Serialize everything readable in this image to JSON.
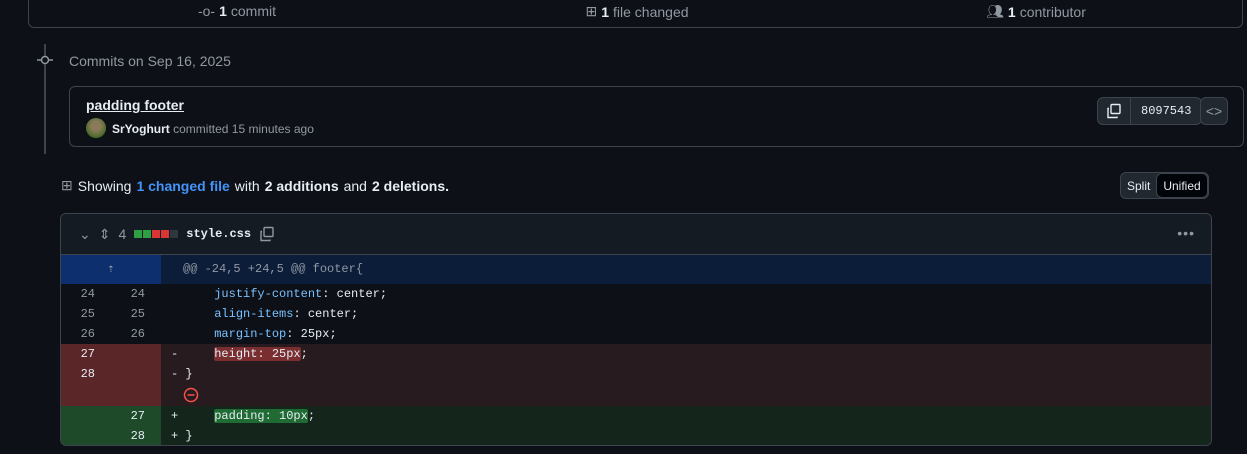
{
  "summary": {
    "commits_n": "1",
    "commits_label": "commit",
    "files_n": "1",
    "files_label": "file changed",
    "contributors_n": "1",
    "contributors_label": "contributor"
  },
  "timeline": {
    "date_label": "Commits on Sep 16, 2025"
  },
  "commit": {
    "title": "padding footer",
    "author": "SrYoghurt",
    "meta": "committed 15 minutes ago",
    "sha": "8097543"
  },
  "showing": {
    "prefix": "Showing",
    "link": "1 changed file",
    "mid": "with",
    "additions": "2 additions",
    "and": "and",
    "deletions": "2 deletions."
  },
  "view_toggle": {
    "split": "Split",
    "unified": "Unified"
  },
  "file": {
    "changes": "4",
    "name": "style.css",
    "colors": {
      "add": "#2ea043",
      "del": "#da3633",
      "neutral": "#30363d"
    },
    "hunk": "@@ -24,5 +24,5 @@ footer{",
    "lines": [
      {
        "type": "ctx",
        "old": "24",
        "new": "24",
        "sign": " ",
        "prop": "justify-content",
        "val": ": center;"
      },
      {
        "type": "ctx",
        "old": "25",
        "new": "25",
        "sign": " ",
        "prop": "align-items",
        "val": ": center;"
      },
      {
        "type": "ctx",
        "old": "26",
        "new": "26",
        "sign": " ",
        "prop": "margin-top",
        "val": ": 25px;"
      }
    ],
    "del1": {
      "old": "27",
      "sign": "-",
      "text": "height: 25px",
      "tail": ";"
    },
    "del2": {
      "old": "28",
      "sign": "-",
      "text": "}"
    },
    "add1": {
      "new": "27",
      "sign": "+",
      "text": "padding: 10px",
      "tail": ";"
    },
    "add2": {
      "new": "28",
      "sign": "+",
      "text": "}"
    }
  }
}
